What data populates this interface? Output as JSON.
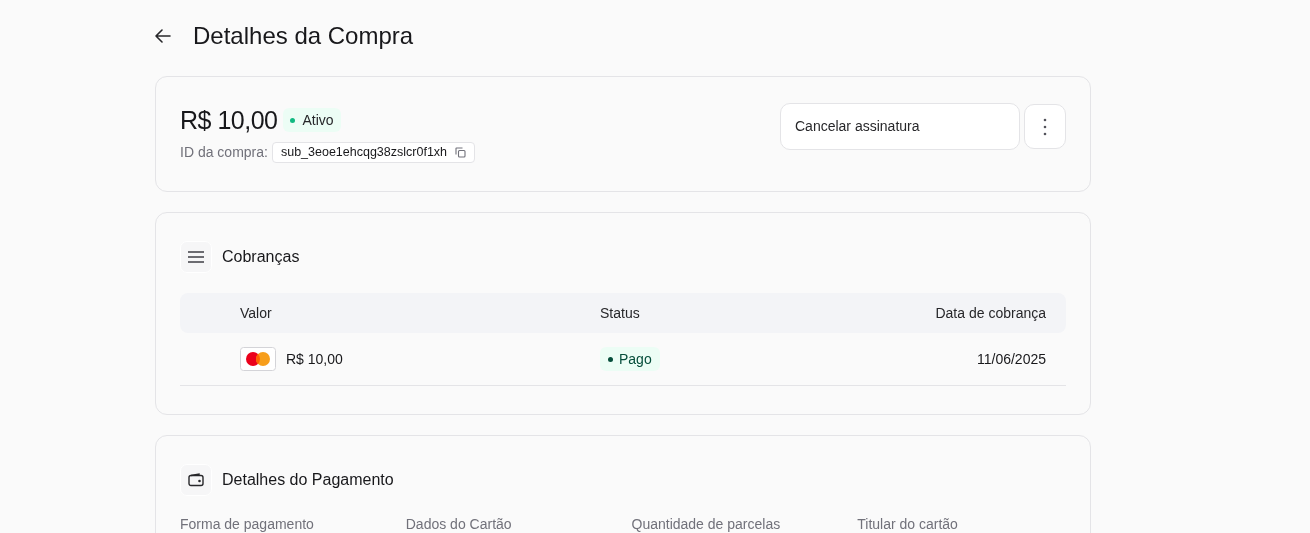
{
  "page": {
    "title": "Detalhes da Compra"
  },
  "summary": {
    "amount": "R$ 10,00",
    "status": "Ativo",
    "id_label": "ID da compra:",
    "id_value": "sub_3eoe1ehcqg38zslcr0f1xh",
    "cancel_button": "Cancelar assinatura"
  },
  "charges": {
    "title": "Cobranças",
    "columns": [
      "Valor",
      "Status",
      "Data de cobrança"
    ],
    "rows": [
      {
        "amount": "R$ 10,00",
        "status": "Pago",
        "date": "11/06/2025"
      }
    ]
  },
  "payment": {
    "title": "Detalhes do Pagamento",
    "fields": [
      "Forma de pagamento",
      "Dados do Cartão",
      "Quantidade de parcelas",
      "Titular do cartão"
    ]
  }
}
